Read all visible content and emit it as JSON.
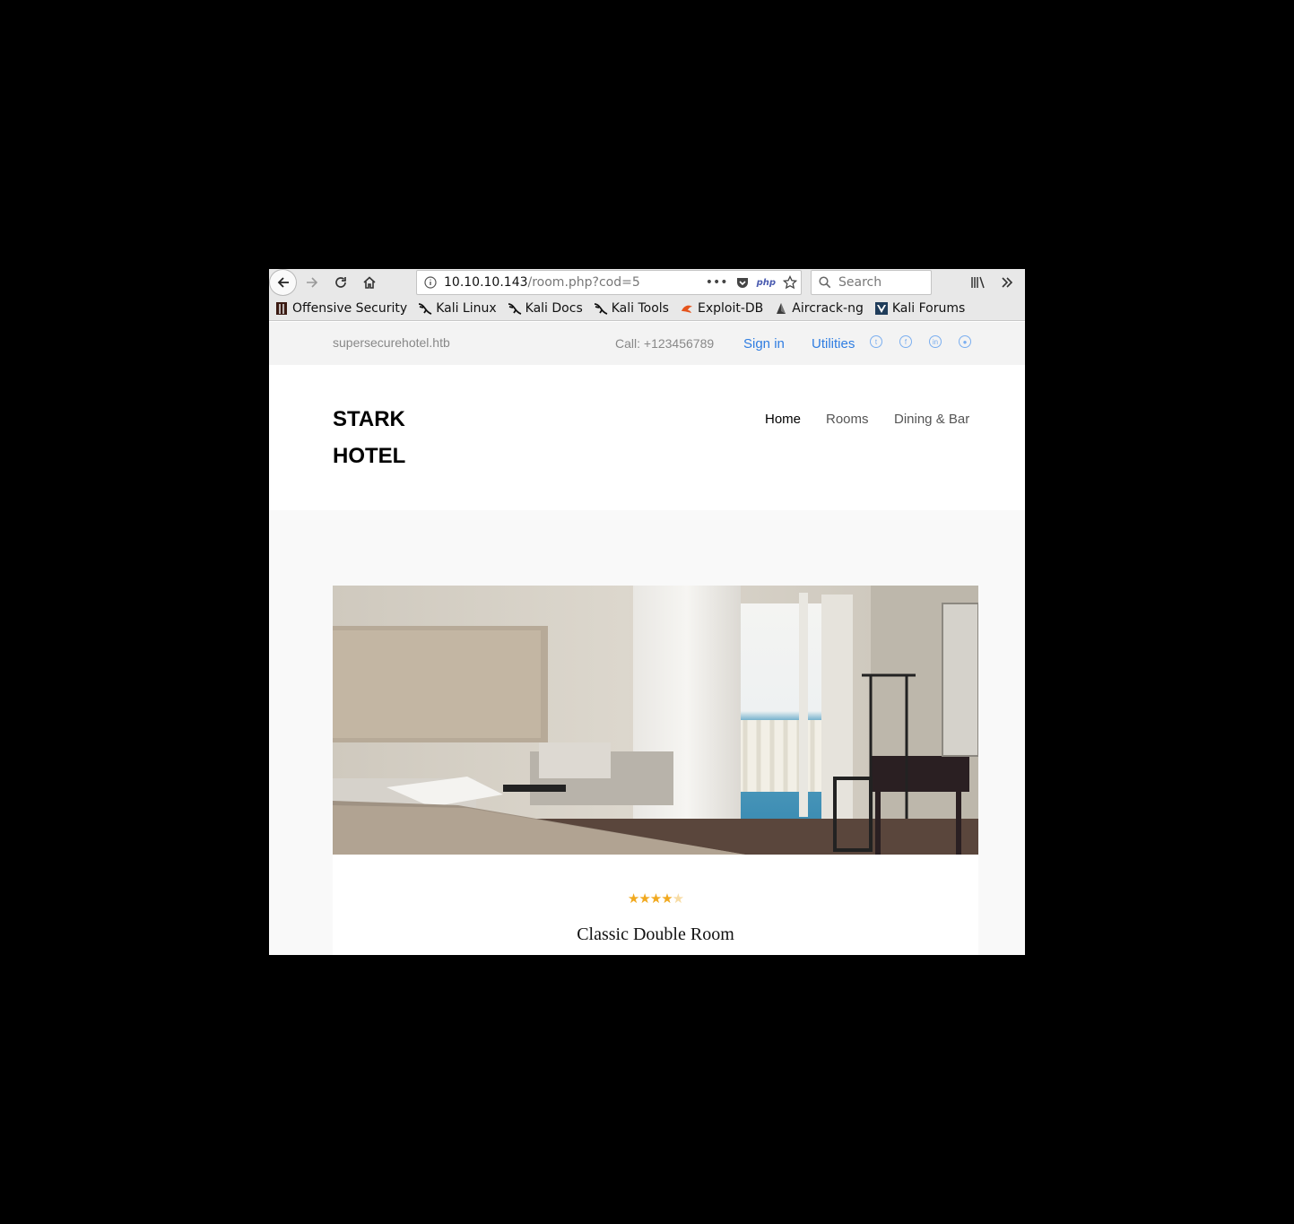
{
  "browser": {
    "url_host": "10.10.10.143",
    "url_path": "/room.php?cod=5",
    "url_more": "•••",
    "php_badge": "php",
    "search_placeholder": "Search",
    "bookmarks": [
      {
        "label": "Offensive Security",
        "icon": "offsec-icon"
      },
      {
        "label": "Kali Linux",
        "icon": "kali-dragon-icon"
      },
      {
        "label": "Kali Docs",
        "icon": "kali-dragon-icon"
      },
      {
        "label": "Kali Tools",
        "icon": "kali-dragon-icon"
      },
      {
        "label": "Exploit-DB",
        "icon": "exploitdb-icon"
      },
      {
        "label": "Aircrack-ng",
        "icon": "aircrack-icon"
      },
      {
        "label": "Kali Forums",
        "icon": "kali-forums-icon"
      }
    ]
  },
  "topbar": {
    "site": "supersecurehotel.htb",
    "call": "Call: +123456789",
    "signin": "Sign in",
    "utilities": "Utilities",
    "social_icons": [
      "twitter-icon",
      "facebook-icon",
      "linkedin-icon",
      "dribbble-icon"
    ]
  },
  "header": {
    "logo_line1": "STARK",
    "logo_line2": "HOTEL",
    "nav": [
      "Home",
      "Rooms",
      "Dining & Bar"
    ],
    "active_nav": "Home"
  },
  "room": {
    "rating": 4,
    "rating_max": 5,
    "title": "Classic Double Room",
    "star_color": "#f1a91f"
  },
  "colors": {
    "link": "#2f7de1",
    "topbar_bg": "#f3f3f3",
    "content_bg": "#f9f9f9"
  }
}
